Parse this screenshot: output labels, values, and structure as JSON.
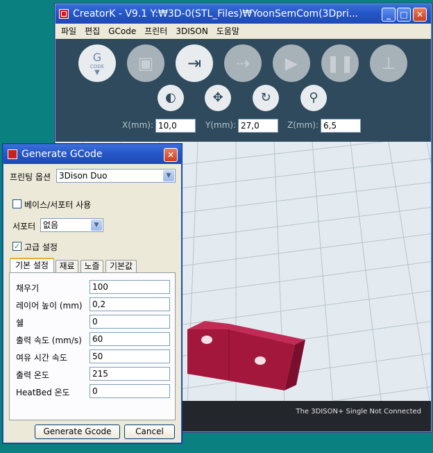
{
  "main_window": {
    "title": "CreatorK - V9.1  Y:₩3D-0(STL_Files)₩YoonSemCom(3Dpri...",
    "menu": [
      "파일",
      "편집",
      "GCode",
      "프린터",
      "3DISON",
      "도움말"
    ],
    "toolbar_icons": [
      "gcode-icon",
      "save-gcode-icon",
      "connect-icon",
      "disconnect-icon",
      "play-icon",
      "pause-icon",
      "bed-level-icon"
    ],
    "gcode_button_label": "G",
    "gcode_button_sublabel": "CODE",
    "view_tools": [
      "mirror-icon",
      "move-icon",
      "rotate-icon",
      "zoom-icon"
    ],
    "coords": {
      "x_label": "X(mm):",
      "x_value": "10,0",
      "y_label": "Y(mm):",
      "y_value": "27,0",
      "z_label": "Z(mm):",
      "z_value": "6,5"
    },
    "status_text": "The 3DISON+ Single Not Connected",
    "colors": {
      "toolbar_bg": "#2e4a5c",
      "model": "#a3173c",
      "grid_bg": "#e4ebf0"
    }
  },
  "dialog": {
    "title": "Generate GCode",
    "printing_option_label": "프린팅 옵션",
    "printing_option_value": "3Dison Duo",
    "base_support_label": "베이스/서포터 사용",
    "base_support_checked": false,
    "support_label": "서포터",
    "support_value": "없음",
    "advanced_label": "고급 설정",
    "advanced_checked": true,
    "tabs": [
      "기본 설정",
      "재료",
      "노즐",
      "기본값"
    ],
    "fields": [
      {
        "label": "채우기",
        "value": "100"
      },
      {
        "label": "레이어 높이 (mm)",
        "value": "0,2"
      },
      {
        "label": "쉘",
        "value": "0"
      },
      {
        "label": "출력 속도 (mm/s)",
        "value": "60"
      },
      {
        "label": "여유 시간 속도",
        "value": "50"
      },
      {
        "label": "출력 온도",
        "value": "215"
      },
      {
        "label": "HeatBed 온도",
        "value": "0"
      }
    ],
    "generate_button": "Generate Gcode",
    "cancel_button": "Cancel"
  }
}
